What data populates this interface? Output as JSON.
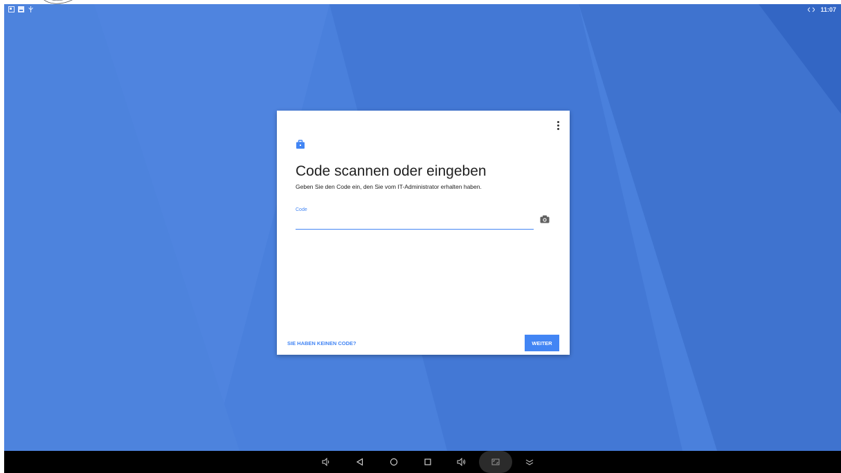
{
  "statusbar": {
    "left_icons": [
      "window-icon",
      "image-icon",
      "usb-icon"
    ],
    "right_icons": [
      "network-arrows-icon"
    ],
    "time": "11:07"
  },
  "dialog": {
    "icon": "briefcase-icon",
    "title": "Code scannen oder eingeben",
    "subtitle": "Geben Sie den Code ein, den Sie vom IT-Administrator erhalten haben.",
    "code_label": "Code",
    "code_value": "",
    "camera_icon": "camera-icon",
    "no_code_link": "SIE HABEN KEINEN CODE?",
    "next_button": "WEITER"
  },
  "navbar": {
    "buttons": [
      "volume-down-icon",
      "back-icon",
      "home-icon",
      "recents-icon",
      "volume-up-icon",
      "screenshot-icon",
      "collapse-icon"
    ]
  },
  "colors": {
    "background": "#4a7fd8",
    "accent": "#4285f4",
    "navbar": "#000000"
  }
}
